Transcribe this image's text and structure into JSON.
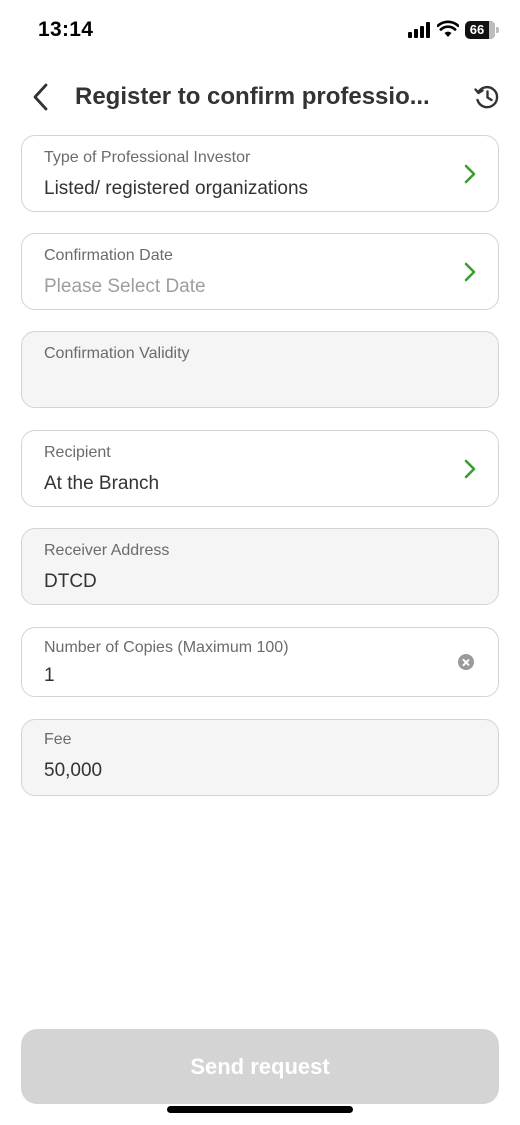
{
  "status_bar": {
    "time": "13:14",
    "battery": "66"
  },
  "header": {
    "title": "Register to confirm professio..."
  },
  "fields": [
    {
      "label": "Type of Professional Investor",
      "value": "Listed/ registered organizations"
    },
    {
      "label": "Confirmation Date",
      "placeholder": "Please Select Date"
    },
    {
      "label": "Confirmation Validity",
      "value": ""
    },
    {
      "label": "Recipient",
      "value": "At the Branch"
    },
    {
      "label": "Receiver Address",
      "value": "DTCD"
    },
    {
      "label": "Number of Copies (Maximum 100)",
      "value": "1"
    },
    {
      "label": "Fee",
      "value": "50,000"
    }
  ],
  "actions": {
    "submit_label": "Send request"
  },
  "colors": {
    "accent": "#3a9d2f",
    "disabled_button": "#d4d4d4",
    "readonly_field": "#f5f5f5"
  },
  "icons": [
    "back-arrow-icon",
    "history-icon",
    "chevron-right-icon",
    "clear-icon"
  ]
}
